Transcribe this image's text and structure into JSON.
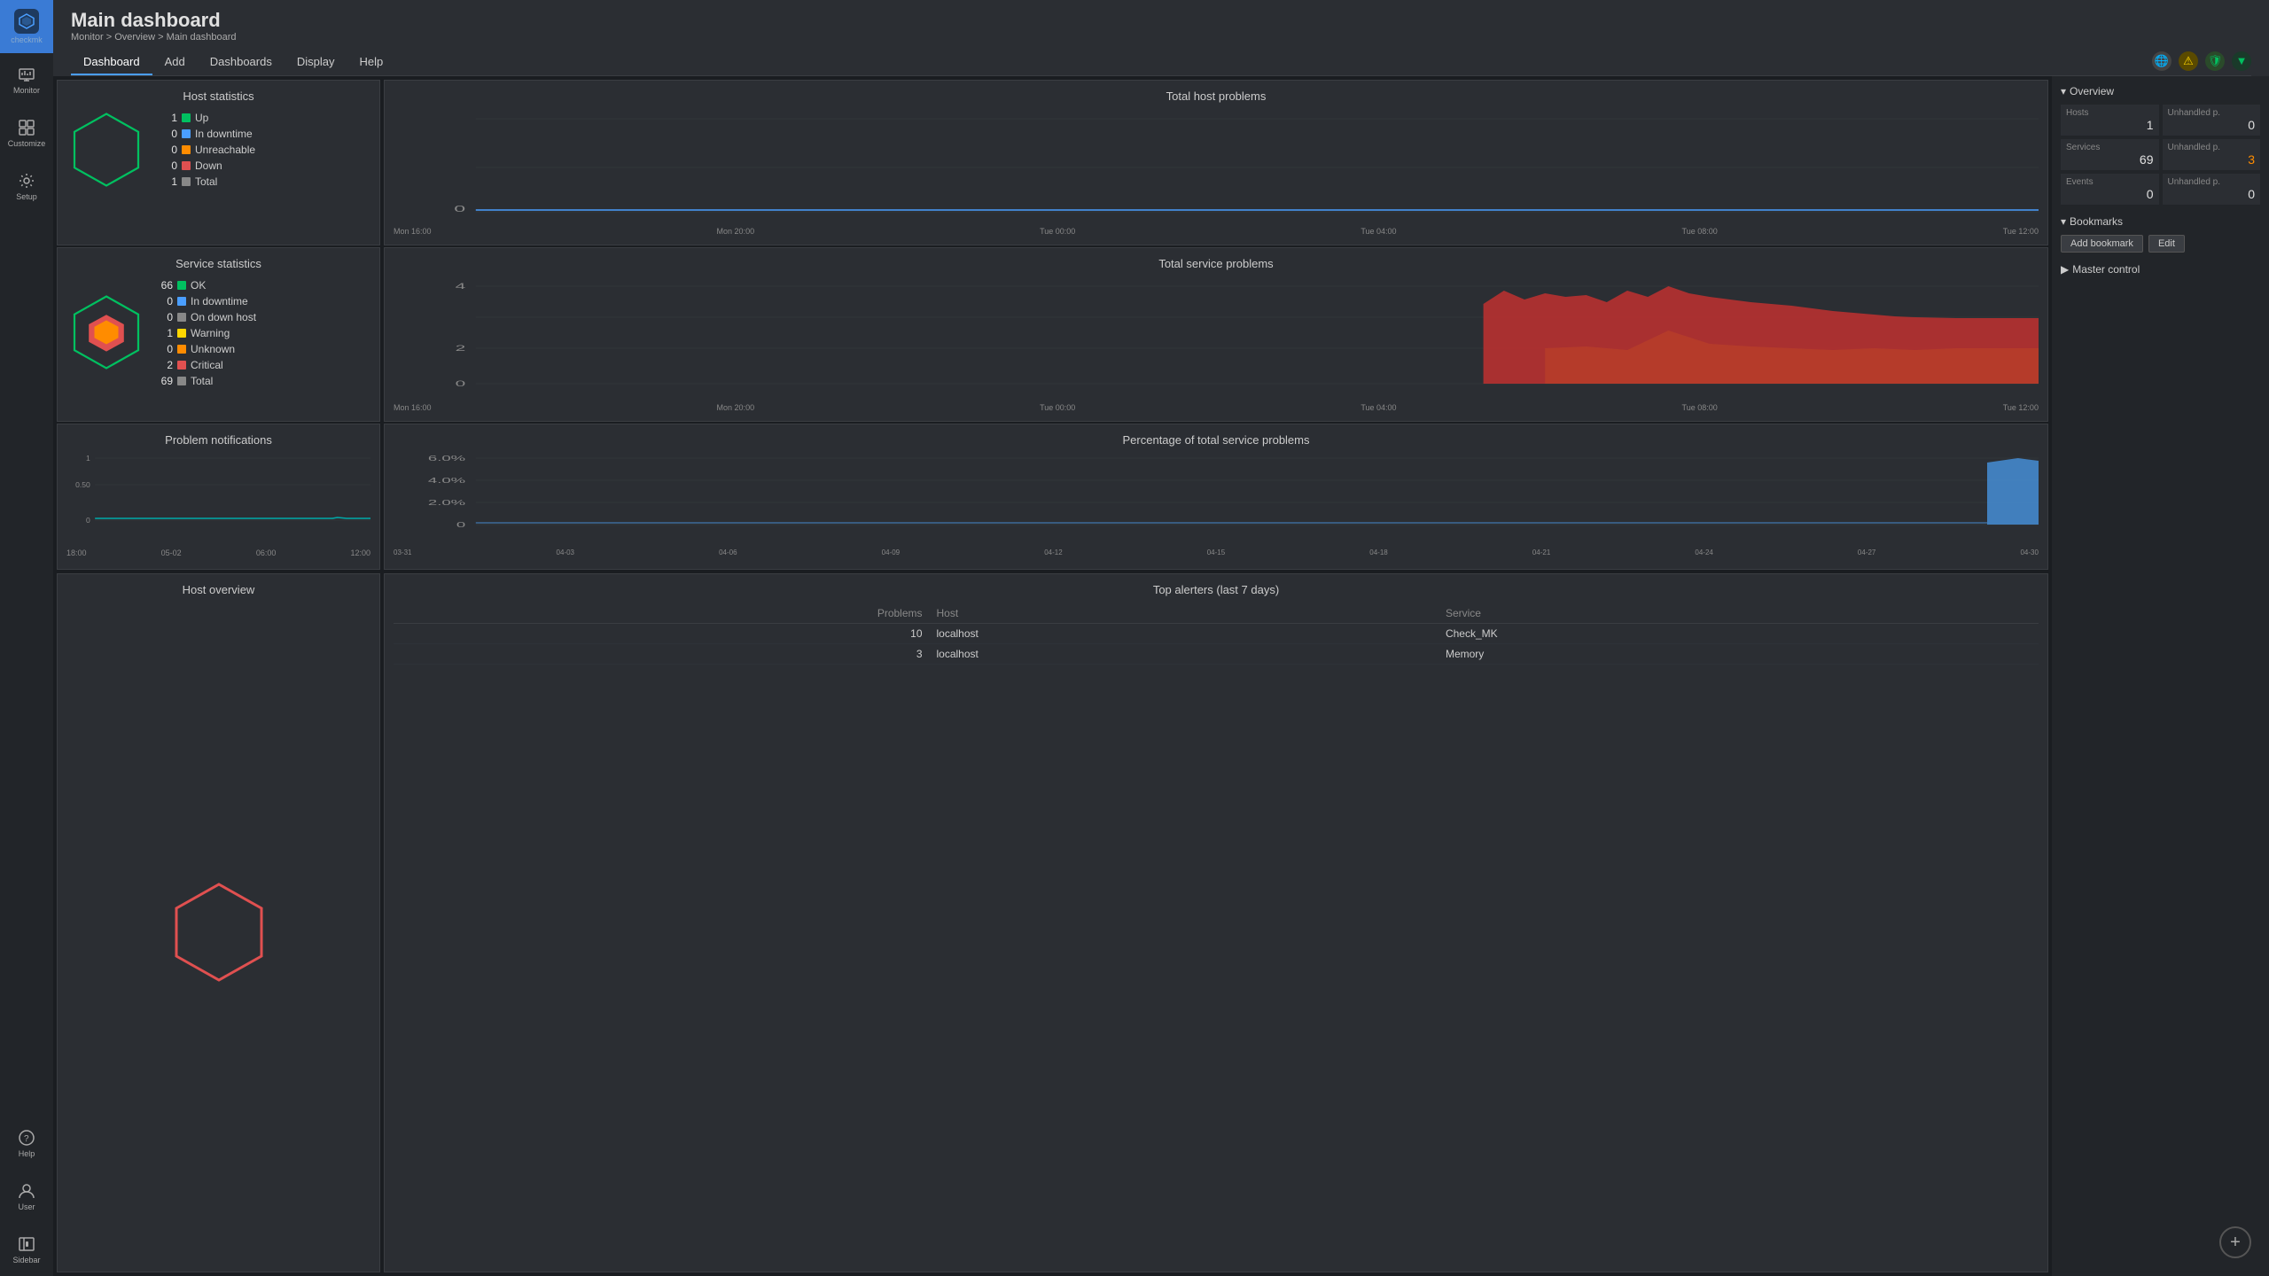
{
  "app": {
    "name": "checkmk",
    "logo_text": "checkmk"
  },
  "breadcrumb": {
    "items": [
      "Monitor",
      "Overview",
      "Main dashboard"
    ]
  },
  "page_title": "Main dashboard",
  "nav": {
    "items": [
      "Dashboard",
      "Add",
      "Dashboards",
      "Display",
      "Help"
    ],
    "active": "Dashboard"
  },
  "host_stats": {
    "title": "Host statistics",
    "items": [
      {
        "num": "1",
        "label": "Up",
        "color": "#00c060"
      },
      {
        "num": "0",
        "label": "In downtime",
        "color": "#4a9eff"
      },
      {
        "num": "0",
        "label": "Unreachable",
        "color": "#ff8c00"
      },
      {
        "num": "0",
        "label": "Down",
        "color": "#e05050"
      },
      {
        "num": "1",
        "label": "Total",
        "color": "#888"
      }
    ]
  },
  "service_stats": {
    "title": "Service statistics",
    "items": [
      {
        "num": "66",
        "label": "OK",
        "color": "#00c060"
      },
      {
        "num": "0",
        "label": "In downtime",
        "color": "#4a9eff"
      },
      {
        "num": "0",
        "label": "On down host",
        "color": "#888"
      },
      {
        "num": "1",
        "label": "Warning",
        "color": "#ffd700"
      },
      {
        "num": "0",
        "label": "Unknown",
        "color": "#ff8c00"
      },
      {
        "num": "2",
        "label": "Critical",
        "color": "#e05050"
      },
      {
        "num": "69",
        "label": "Total",
        "color": "#888"
      }
    ]
  },
  "total_host_problems": {
    "title": "Total host problems",
    "x_labels": [
      "Mon 16:00",
      "Mon 20:00",
      "Tue 00:00",
      "Tue 04:00",
      "Tue 08:00",
      "Tue 12:00"
    ]
  },
  "total_service_problems": {
    "title": "Total service problems",
    "x_labels": [
      "Mon 16:00",
      "Mon 20:00",
      "Tue 00:00",
      "Tue 04:00",
      "Tue 08:00",
      "Tue 12:00"
    ]
  },
  "problem_notifications": {
    "title": "Problem notifications",
    "y_labels": [
      "1",
      "0.50",
      "0"
    ],
    "x_labels": [
      "18:00",
      "05-02",
      "06:00",
      "12:00"
    ]
  },
  "pct_service_problems": {
    "title": "Percentage of total service problems",
    "y_labels": [
      "6.0%",
      "4.0%",
      "2.0%",
      "0"
    ],
    "x_labels": [
      "03-31",
      "04-03",
      "04-06",
      "04-09",
      "04-12",
      "04-15",
      "04-18",
      "04-21",
      "04-24",
      "04-27",
      "04-30"
    ]
  },
  "host_overview": {
    "title": "Host overview"
  },
  "top_alerters": {
    "title": "Top alerters (last 7 days)",
    "headers": [
      "Problems",
      "Host",
      "Service"
    ],
    "rows": [
      {
        "problems": "10",
        "host": "localhost",
        "service": "Check_MK"
      },
      {
        "problems": "3",
        "host": "localhost",
        "service": "Memory"
      }
    ]
  },
  "right_sidebar": {
    "overview": {
      "title": "Overview",
      "hosts_label": "Hosts",
      "hosts_value": "1",
      "unhandled_hosts_label": "Unhandled p.",
      "unhandled_hosts_value": "0",
      "services_label": "Services",
      "services_value": "69",
      "unhandled_services_label": "Unhandled p.",
      "unhandled_services_value": "3",
      "events_label": "Events",
      "events_value": "0",
      "unhandled_events_label": "Unhandled p.",
      "unhandled_events_value": "0"
    },
    "bookmarks": {
      "title": "Bookmarks",
      "add_label": "Add bookmark",
      "edit_label": "Edit"
    },
    "master_control": {
      "title": "Master control"
    }
  }
}
